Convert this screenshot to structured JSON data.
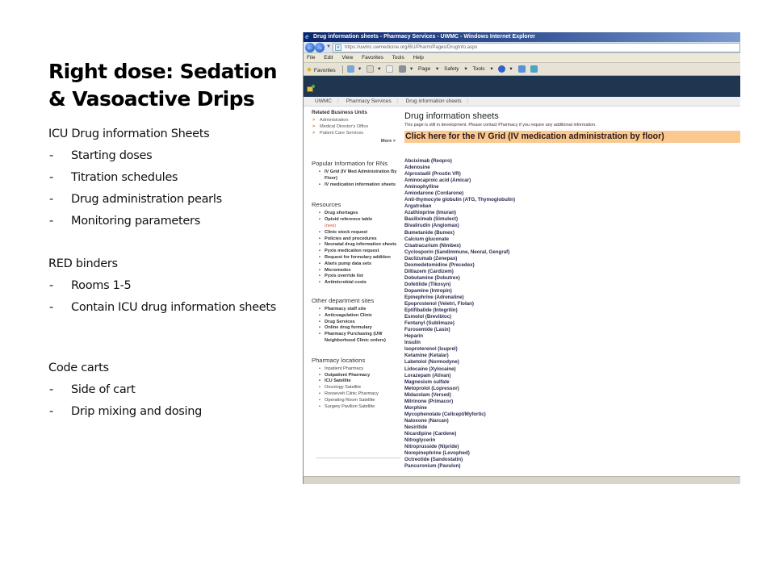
{
  "slide": {
    "title": "Right dose: Sedation & Vasoactive Drips",
    "sections": [
      {
        "heading": "ICU Drug information Sheets",
        "bullets": [
          "Starting doses",
          "Titration schedules",
          "Drug administration pearls",
          "Monitoring parameters"
        ]
      },
      {
        "heading": "RED binders",
        "bullets": [
          "Rooms 1-5",
          "Contain ICU drug information sheets"
        ]
      },
      {
        "heading": "Code carts",
        "bullets": [
          "Side of cart",
          "Drip mixing and dosing"
        ]
      }
    ],
    "bullet_marker": "-"
  },
  "browser": {
    "window_title": "Drug information sheets - Pharmacy Services - UWMC - Windows Internet Explorer",
    "url": "https://uwmc.uwmedicine.org/BU/Pharm/Pages/DrugInfo.aspx",
    "menu": [
      "File",
      "Edit",
      "View",
      "Favorites",
      "Tools",
      "Help"
    ],
    "command_bar": {
      "favorites": "Favorites",
      "page": "Page",
      "safety": "Safety",
      "tools": "Tools"
    },
    "breadcrumb": [
      "UWMC",
      "Pharmacy Services",
      "Drug information sheets"
    ],
    "colors": {
      "header_bg": "#1f3650",
      "highlight_bg": "#fbc98f",
      "new_tag": "#d04a3a"
    }
  },
  "sidebar": {
    "related_units": {
      "title": "Related Business Units",
      "items": [
        "Administration",
        "Medical Director's Office",
        "Patient Care Services"
      ],
      "more": "More >"
    },
    "popular": {
      "title": "Popular Information for RNs",
      "items": [
        "IV Grid (IV Med Administration By Floor)",
        "IV medication information sheets"
      ]
    },
    "resources": {
      "title": "Resources",
      "items": [
        {
          "label": "Drug shortages"
        },
        {
          "label": "Opioid reference table",
          "tag": "(new)"
        },
        {
          "label": "Clinic stock request"
        },
        {
          "label": "Policies and procedures"
        },
        {
          "label": "Neonatal drug information sheets"
        },
        {
          "label": "Pyxis medication request"
        },
        {
          "label": "Request for formulary addition"
        },
        {
          "label": "Alaris pump data sets"
        },
        {
          "label": "Micromedex"
        },
        {
          "label": "Pyxis override list"
        },
        {
          "label": "Antimicrobial costs"
        }
      ]
    },
    "other_sites": {
      "title": "Other department sites",
      "items": [
        "Pharmacy staff site",
        "Anticoagulation Clinic",
        "Drug Services",
        "Online drug formulary",
        "Pharmacy Purchasing (UW Neighborhood Clinic orders)"
      ]
    },
    "locations": {
      "title": "Pharmacy locations",
      "items": [
        {
          "label": "Inpatient Pharmacy",
          "bold": false
        },
        {
          "label": "Outpatient Pharmacy",
          "bold": true
        },
        {
          "label": "ICU Satellite",
          "bold": true
        },
        {
          "label": "Oncology Satellite",
          "bold": false
        },
        {
          "label": "Roosevelt Clinic Pharmacy",
          "bold": false
        },
        {
          "label": "Operating Room Satellite",
          "bold": false
        },
        {
          "label": "Surgery Pavilion Satellite",
          "bold": false
        }
      ]
    }
  },
  "main": {
    "title": "Drug information sheets",
    "note": "This page is still in development. Please contact Pharmacy if you require any additional information.",
    "iv_grid_link": "Click here for the IV Grid (IV medication administration by floor)",
    "drugs": [
      "Abciximab (Reopro)",
      "Adenosine",
      "Alprostadil (Prostin VR)",
      "Aminocaproic acid (Amicar)",
      "Aminophylline",
      "Amiodarone (Cordarone)",
      "Anti-thymocyte globulin (ATG, Thymoglobulin)",
      "Argatroban",
      "Azathioprine (Imuran)",
      "Basiliximab (Simulect)",
      "Bivalirudin (Angiomax)",
      "Bumetanide (Bumex)",
      "Calcium gluconate",
      "Cisatracurium (Nimbex)",
      "Cyclosporin (Sandimmune, Neoral, Gengraf)",
      "Daclizumab (Zenepax)",
      "Dexmedetomidine (Precedex)",
      "Diltiazem (Cardizem)",
      "Dobutamine (Dobutrex)",
      "Dofetilide (Tikosyn)",
      "Dopamine (Intropin)",
      "Epinephrine (Adrenaline)",
      "Epoprostenol (Veletri, Flolan)",
      "Eptifibatide (Integrilin)",
      "Esmolol (Brevibloc)",
      "Fentanyl (Sublimaze)",
      "Furosemide (Lasix)",
      "Heparin",
      "Insulin",
      "Isoproterenol (Isuprel)",
      "Ketamine (Ketalar)",
      "Labetolol (Normodyne)",
      "Lidocaine (Xylocaine)",
      "Lorazepam (Ativan)",
      "Magnesium sulfate",
      "Metoprolol (Lopressor)",
      "Midazolam (Versed)",
      "Milrinone (Primacor)",
      "Morphine",
      "Mycophenolate (Cellcept/Myfortic)",
      "Naloxone (Narcan)",
      "Nesiritide",
      "Nicardipine (Cardene)",
      "Nitroglycerin",
      "Nitroprusside (Nipride)",
      "Norepinephrine (Levophed)",
      "Octreotide (Sandostatin)",
      "Pancuronium (Pavulon)"
    ]
  }
}
